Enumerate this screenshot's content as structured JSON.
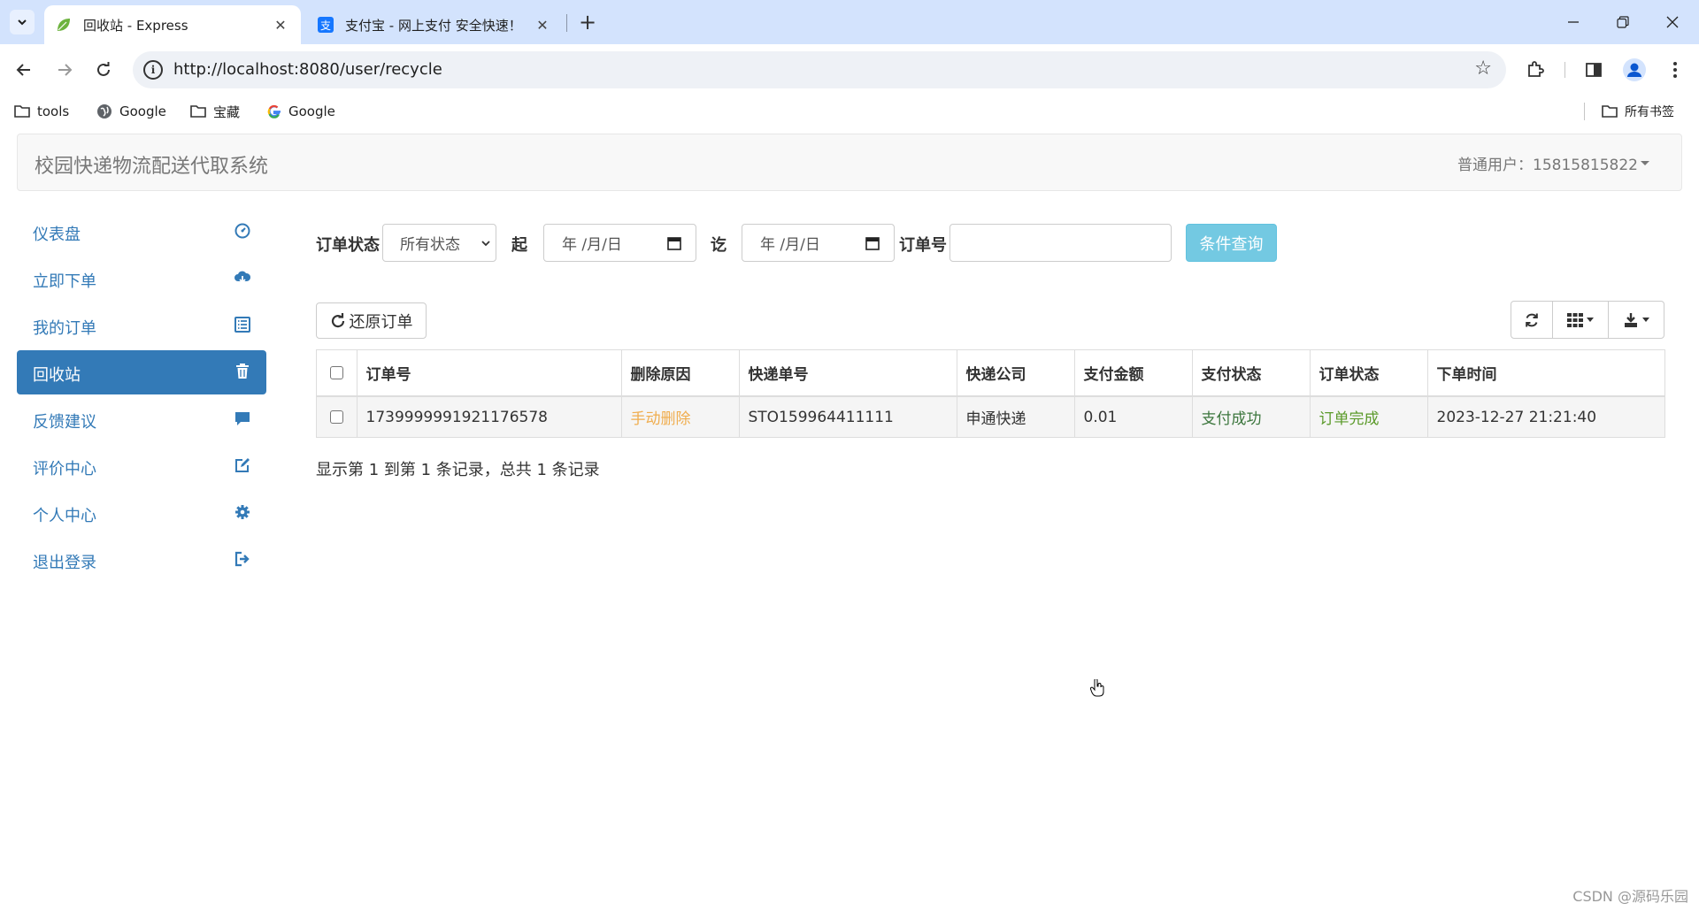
{
  "browser": {
    "tabs": [
      {
        "title": "回收站 - Express",
        "active": true,
        "icon": "leaf-icon"
      },
      {
        "title": "支付宝 - 网上支付 安全快速！",
        "active": false,
        "icon": "alipay-icon"
      }
    ],
    "url": "http://localhost:8080/user/recycle",
    "bookmarks": [
      {
        "label": "tools",
        "icon": "folder-icon"
      },
      {
        "label": "Google",
        "icon": "globe-icon"
      },
      {
        "label": "宝藏",
        "icon": "folder-icon"
      },
      {
        "label": "Google",
        "icon": "google-icon"
      }
    ],
    "bookmarks_right": "所有书签"
  },
  "app": {
    "brand": "校园快递物流配送代取系统",
    "user": "普通用户：15815815822"
  },
  "sidebar": {
    "items": [
      {
        "label": "仪表盘",
        "icon": "dashboard-icon",
        "active": false
      },
      {
        "label": "立即下单",
        "icon": "cloud-download-icon",
        "active": false
      },
      {
        "label": "我的订单",
        "icon": "list-icon",
        "active": false
      },
      {
        "label": "回收站",
        "icon": "trash-icon",
        "active": true
      },
      {
        "label": "反馈建议",
        "icon": "comment-icon",
        "active": false
      },
      {
        "label": "评价中心",
        "icon": "edit-icon",
        "active": false
      },
      {
        "label": "个人中心",
        "icon": "cog-icon",
        "active": false
      },
      {
        "label": "退出登录",
        "icon": "logout-icon",
        "active": false
      }
    ]
  },
  "filter": {
    "status_label": "订单状态",
    "status_value": "所有状态",
    "from_label": "起",
    "date_placeholder": "年 /月/日",
    "to_label": "讫",
    "order_no_label": "订单号",
    "order_no_value": "",
    "query_button": "条件查询"
  },
  "toolbar": {
    "restore_button": "还原订单"
  },
  "table": {
    "columns": [
      "订单号",
      "删除原因",
      "快递单号",
      "快递公司",
      "支付金额",
      "支付状态",
      "订单状态",
      "下单时间"
    ],
    "rows": [
      [
        "1739999991921176578",
        "手动删除",
        "STO159964411111",
        "申通快递",
        "0.01",
        "支付成功",
        "订单完成",
        "2023-12-27 21:21:40"
      ]
    ]
  },
  "pagination": {
    "info": "显示第 1 到第 1 条记录，总共 1 条记录"
  },
  "watermark": "CSDN @源码乐园"
}
